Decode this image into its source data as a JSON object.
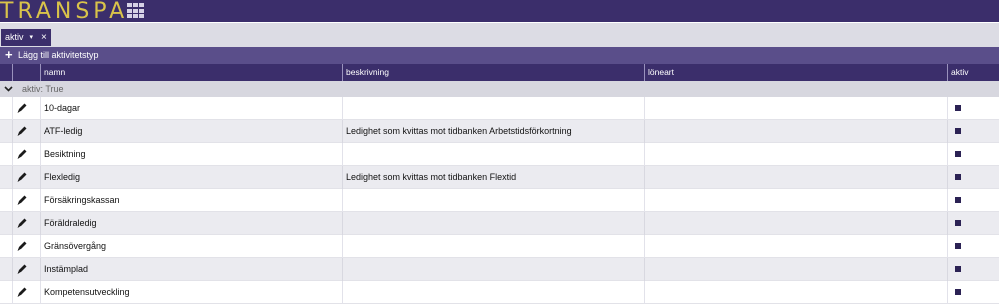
{
  "app": {
    "logo_text": "TRANSPA",
    "apps_icon": "grid-icon",
    "colors": {
      "primary": "#3b2e6b",
      "toolbar": "#5a4e8a",
      "logo": "#d9c34a"
    }
  },
  "filter_tab": {
    "label": "aktiv",
    "caret": "▾",
    "close": "×"
  },
  "toolbar": {
    "add_icon": "+",
    "add_label": "Lägg till aktivitetstyp"
  },
  "columns": {
    "name": "namn",
    "description": "beskrivning",
    "wage_type": "löneart",
    "active": "aktiv"
  },
  "group": {
    "label": "aktiv: True",
    "chevron": "⌄"
  },
  "rows": [
    {
      "name": "10-dagar",
      "description": "",
      "wage_type": "",
      "active": true
    },
    {
      "name": "ATF-ledig",
      "description": "Ledighet som kvittas mot tidbanken Arbetstidsförkortning",
      "wage_type": "",
      "active": true
    },
    {
      "name": "Besiktning",
      "description": "",
      "wage_type": "",
      "active": true
    },
    {
      "name": "Flexledig",
      "description": "Ledighet som kvittas mot tidbanken Flextid",
      "wage_type": "",
      "active": true
    },
    {
      "name": "Försäkringskassan",
      "description": "",
      "wage_type": "",
      "active": true
    },
    {
      "name": "Föräldraledig",
      "description": "",
      "wage_type": "",
      "active": true
    },
    {
      "name": "Gränsövergång",
      "description": "",
      "wage_type": "",
      "active": true
    },
    {
      "name": "Instämplad",
      "description": "",
      "wage_type": "",
      "active": true
    },
    {
      "name": "Kompetensutveckling",
      "description": "",
      "wage_type": "",
      "active": true
    }
  ]
}
